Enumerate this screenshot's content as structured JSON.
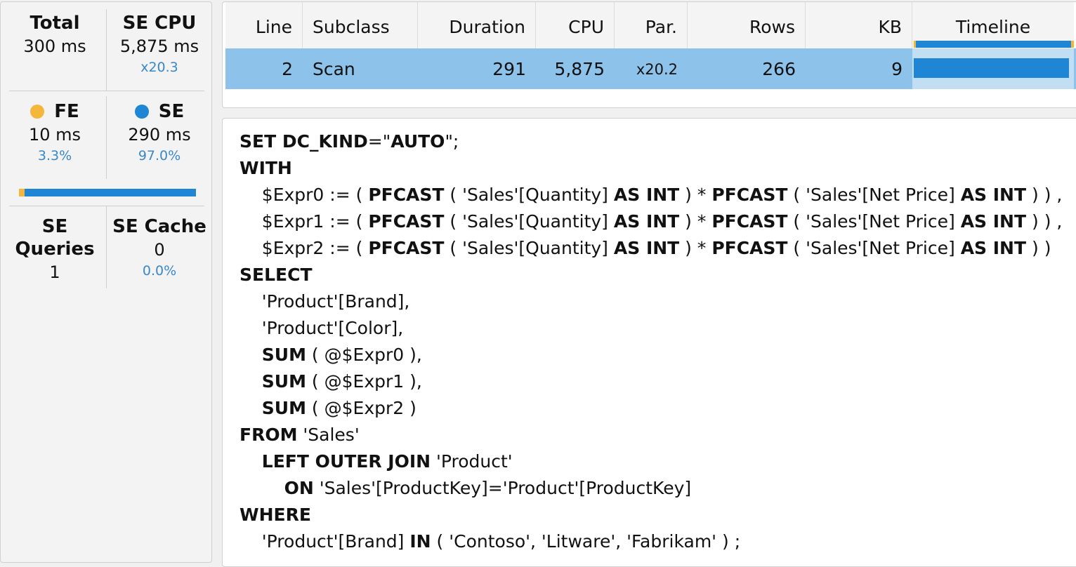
{
  "metrics": {
    "total": {
      "title": "Total",
      "value": "300 ms"
    },
    "se_cpu": {
      "title": "SE CPU",
      "value": "5,875 ms",
      "sub": "x20.3"
    },
    "fe": {
      "title": "FE",
      "value": "10 ms",
      "sub": "3.3%",
      "color": "#f4b63b"
    },
    "se": {
      "title": "SE",
      "value": "290 ms",
      "sub": "97.0%",
      "color": "#1f86d6"
    },
    "fe_share_percent": 3.3,
    "se_queries": {
      "title": "SE Queries",
      "value": "1"
    },
    "se_cache": {
      "title": "SE Cache",
      "value": "0",
      "sub": "0.0%"
    }
  },
  "table": {
    "headers": [
      "Line",
      "Subclass",
      "Duration",
      "CPU",
      "Par.",
      "Rows",
      "KB",
      "Timeline"
    ],
    "rows": [
      {
        "line": "2",
        "subclass": "Scan",
        "duration": "291",
        "cpu": "5,875",
        "par": "x20.2",
        "rows": "266",
        "kb": "9",
        "timeline_fraction": 0.98
      }
    ],
    "selected_row_color": "#8dc2ea"
  },
  "code": {
    "lines": [
      [
        [
          "b",
          "SET DC_KIND"
        ],
        [
          "t",
          "=\""
        ],
        [
          "b",
          "AUTO"
        ],
        [
          "t",
          "\";"
        ]
      ],
      [
        [
          "b",
          "WITH"
        ]
      ],
      [
        [
          "t",
          "    $Expr0 := ( "
        ],
        [
          "b",
          "PFCAST"
        ],
        [
          "t",
          " ( 'Sales'[Quantity] "
        ],
        [
          "b",
          "AS INT"
        ],
        [
          "t",
          " ) * "
        ],
        [
          "b",
          "PFCAST"
        ],
        [
          "t",
          " ( 'Sales'[Net Price] "
        ],
        [
          "b",
          "AS INT"
        ],
        [
          "t",
          " ) ) ,"
        ]
      ],
      [
        [
          "t",
          "    $Expr1 := ( "
        ],
        [
          "b",
          "PFCAST"
        ],
        [
          "t",
          " ( 'Sales'[Quantity] "
        ],
        [
          "b",
          "AS INT"
        ],
        [
          "t",
          " ) * "
        ],
        [
          "b",
          "PFCAST"
        ],
        [
          "t",
          " ( 'Sales'[Net Price] "
        ],
        [
          "b",
          "AS INT"
        ],
        [
          "t",
          " ) ) ,"
        ]
      ],
      [
        [
          "t",
          "    $Expr2 := ( "
        ],
        [
          "b",
          "PFCAST"
        ],
        [
          "t",
          " ( 'Sales'[Quantity] "
        ],
        [
          "b",
          "AS INT"
        ],
        [
          "t",
          " ) * "
        ],
        [
          "b",
          "PFCAST"
        ],
        [
          "t",
          " ( 'Sales'[Net Price] "
        ],
        [
          "b",
          "AS INT"
        ],
        [
          "t",
          " ) )"
        ]
      ],
      [
        [
          "b",
          "SELECT"
        ]
      ],
      [
        [
          "t",
          "    'Product'[Brand],"
        ]
      ],
      [
        [
          "t",
          "    'Product'[Color],"
        ]
      ],
      [
        [
          "t",
          "    "
        ],
        [
          "b",
          "SUM"
        ],
        [
          "t",
          " ( @$Expr0 ),"
        ]
      ],
      [
        [
          "t",
          "    "
        ],
        [
          "b",
          "SUM"
        ],
        [
          "t",
          " ( @$Expr1 ),"
        ]
      ],
      [
        [
          "t",
          "    "
        ],
        [
          "b",
          "SUM"
        ],
        [
          "t",
          " ( @$Expr2 )"
        ]
      ],
      [
        [
          "b",
          "FROM"
        ],
        [
          "t",
          " 'Sales'"
        ]
      ],
      [
        [
          "t",
          "    "
        ],
        [
          "b",
          "LEFT OUTER JOIN"
        ],
        [
          "t",
          " 'Product'"
        ]
      ],
      [
        [
          "t",
          "        "
        ],
        [
          "b",
          "ON"
        ],
        [
          "t",
          " 'Sales'[ProductKey]='Product'[ProductKey]"
        ]
      ],
      [
        [
          "b",
          "WHERE"
        ]
      ],
      [
        [
          "t",
          "    'Product'[Brand] "
        ],
        [
          "b",
          "IN"
        ],
        [
          "t",
          " ( 'Contoso', 'Litware', 'Fabrikam' ) ;"
        ]
      ]
    ]
  }
}
